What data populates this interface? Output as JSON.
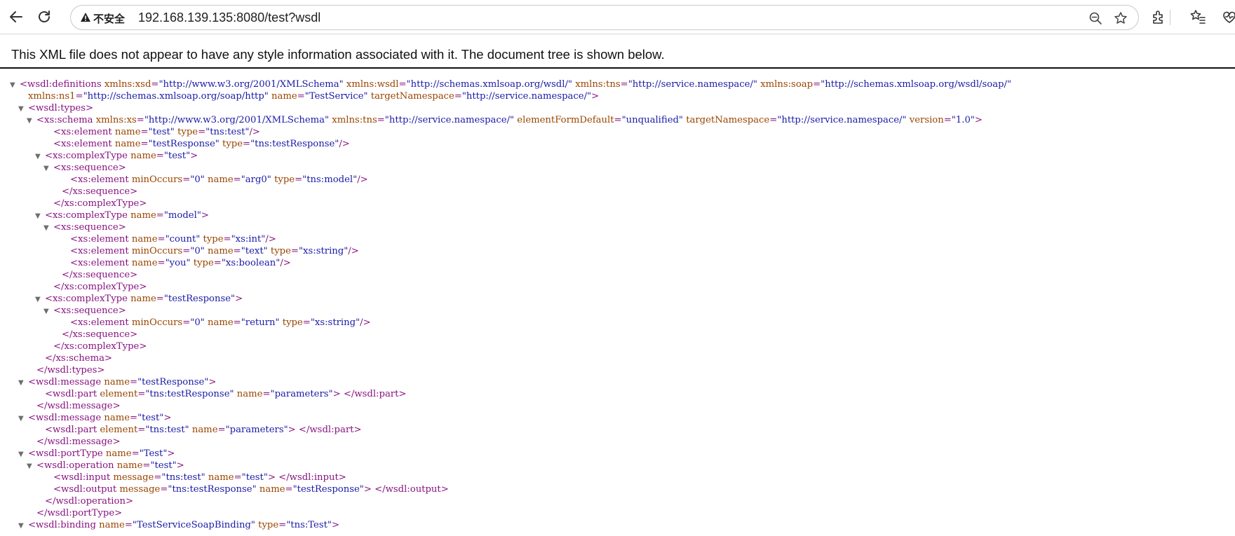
{
  "browser": {
    "security_label": "不安全",
    "url": "192.168.139.135:8080/test?wsdl",
    "icons": [
      "back-arrow-icon",
      "reload-icon",
      "warning-icon",
      "zoom-icon",
      "star-icon",
      "extensions-icon",
      "favorites-icon",
      "heart-pulse-icon"
    ]
  },
  "notice": "This XML file does not appear to have any style information associated with it. The document tree is shown below.",
  "colors": {
    "tag": "#881280",
    "attr": "#994500",
    "value": "#1a1aa6",
    "toggle": "#6e6e6e"
  },
  "xml_lines": [
    {
      "toggle": true,
      "parts": [
        [
          "t",
          "<wsdl:definitions "
        ],
        [
          "a",
          "xmlns:xsd"
        ],
        [
          "t",
          "="
        ],
        [
          "v",
          "\"http://www.w3.org/2001/XMLSchema\""
        ],
        [
          "t",
          " "
        ],
        [
          "a",
          "xmlns:wsdl"
        ],
        [
          "t",
          "="
        ],
        [
          "v",
          "\"http://schemas.xmlsoap.org/wsdl/\""
        ],
        [
          "t",
          " "
        ],
        [
          "a",
          "xmlns:tns"
        ],
        [
          "t",
          "="
        ],
        [
          "v",
          "\"http://service.namespace/\""
        ],
        [
          "t",
          " "
        ],
        [
          "a",
          "xmlns:soap"
        ],
        [
          "t",
          "="
        ],
        [
          "v",
          "\"http://schemas.xmlsoap.org/wsdl/soap/\""
        ]
      ]
    },
    {
      "indent": 1,
      "parts": [
        [
          "a",
          "xmlns:ns1"
        ],
        [
          "t",
          "="
        ],
        [
          "v",
          "\"http://schemas.xmlsoap.org/soap/http\""
        ],
        [
          "t",
          " "
        ],
        [
          "a",
          "name"
        ],
        [
          "t",
          "="
        ],
        [
          "v",
          "\"TestService\""
        ],
        [
          "t",
          " "
        ],
        [
          "a",
          "targetNamespace"
        ],
        [
          "t",
          "="
        ],
        [
          "v",
          "\"http://service.namespace/\""
        ],
        [
          "t",
          ">"
        ]
      ]
    },
    {
      "indent": 1,
      "toggle": true,
      "parts": [
        [
          "t",
          "<wsdl:types>"
        ]
      ]
    },
    {
      "indent": 2,
      "toggle": true,
      "parts": [
        [
          "t",
          "<xs:schema "
        ],
        [
          "a",
          "xmlns:xs"
        ],
        [
          "t",
          "="
        ],
        [
          "v",
          "\"http://www.w3.org/2001/XMLSchema\""
        ],
        [
          "t",
          " "
        ],
        [
          "a",
          "xmlns:tns"
        ],
        [
          "t",
          "="
        ],
        [
          "v",
          "\"http://service.namespace/\""
        ],
        [
          "t",
          " "
        ],
        [
          "a",
          "elementFormDefault"
        ],
        [
          "t",
          "="
        ],
        [
          "v",
          "\"unqualified\""
        ],
        [
          "t",
          " "
        ],
        [
          "a",
          "targetNamespace"
        ],
        [
          "t",
          "="
        ],
        [
          "v",
          "\"http://service.namespace/\""
        ],
        [
          "t",
          " "
        ],
        [
          "a",
          "version"
        ],
        [
          "t",
          "="
        ],
        [
          "v",
          "\"1.0\""
        ],
        [
          "t",
          ">"
        ]
      ]
    },
    {
      "indent": 4,
      "parts": [
        [
          "t",
          "<xs:element "
        ],
        [
          "a",
          "name"
        ],
        [
          "t",
          "="
        ],
        [
          "v",
          "\"test\""
        ],
        [
          "t",
          " "
        ],
        [
          "a",
          "type"
        ],
        [
          "t",
          "="
        ],
        [
          "v",
          "\"tns:test\""
        ],
        [
          "t",
          "/>"
        ]
      ]
    },
    {
      "indent": 4,
      "parts": [
        [
          "t",
          "<xs:element "
        ],
        [
          "a",
          "name"
        ],
        [
          "t",
          "="
        ],
        [
          "v",
          "\"testResponse\""
        ],
        [
          "t",
          " "
        ],
        [
          "a",
          "type"
        ],
        [
          "t",
          "="
        ],
        [
          "v",
          "\"tns:testResponse\""
        ],
        [
          "t",
          "/>"
        ]
      ]
    },
    {
      "indent": 3,
      "toggle": true,
      "parts": [
        [
          "t",
          "<xs:complexType "
        ],
        [
          "a",
          "name"
        ],
        [
          "t",
          "="
        ],
        [
          "v",
          "\"test\""
        ],
        [
          "t",
          ">"
        ]
      ]
    },
    {
      "indent": 4,
      "toggle": true,
      "parts": [
        [
          "t",
          "<xs:sequence>"
        ]
      ]
    },
    {
      "indent": 6,
      "parts": [
        [
          "t",
          "<xs:element "
        ],
        [
          "a",
          "minOccurs"
        ],
        [
          "t",
          "="
        ],
        [
          "v",
          "\"0\""
        ],
        [
          "t",
          " "
        ],
        [
          "a",
          "name"
        ],
        [
          "t",
          "="
        ],
        [
          "v",
          "\"arg0\""
        ],
        [
          "t",
          " "
        ],
        [
          "a",
          "type"
        ],
        [
          "t",
          "="
        ],
        [
          "v",
          "\"tns:model\""
        ],
        [
          "t",
          "/>"
        ]
      ]
    },
    {
      "indent": 5,
      "parts": [
        [
          "t",
          "</xs:sequence>"
        ]
      ]
    },
    {
      "indent": 4,
      "parts": [
        [
          "t",
          "</xs:complexType>"
        ]
      ]
    },
    {
      "indent": 3,
      "toggle": true,
      "parts": [
        [
          "t",
          "<xs:complexType "
        ],
        [
          "a",
          "name"
        ],
        [
          "t",
          "="
        ],
        [
          "v",
          "\"model\""
        ],
        [
          "t",
          ">"
        ]
      ]
    },
    {
      "indent": 4,
      "toggle": true,
      "parts": [
        [
          "t",
          "<xs:sequence>"
        ]
      ]
    },
    {
      "indent": 6,
      "parts": [
        [
          "t",
          "<xs:element "
        ],
        [
          "a",
          "name"
        ],
        [
          "t",
          "="
        ],
        [
          "v",
          "\"count\""
        ],
        [
          "t",
          " "
        ],
        [
          "a",
          "type"
        ],
        [
          "t",
          "="
        ],
        [
          "v",
          "\"xs:int\""
        ],
        [
          "t",
          "/>"
        ]
      ]
    },
    {
      "indent": 6,
      "parts": [
        [
          "t",
          "<xs:element "
        ],
        [
          "a",
          "minOccurs"
        ],
        [
          "t",
          "="
        ],
        [
          "v",
          "\"0\""
        ],
        [
          "t",
          " "
        ],
        [
          "a",
          "name"
        ],
        [
          "t",
          "="
        ],
        [
          "v",
          "\"text\""
        ],
        [
          "t",
          " "
        ],
        [
          "a",
          "type"
        ],
        [
          "t",
          "="
        ],
        [
          "v",
          "\"xs:string\""
        ],
        [
          "t",
          "/>"
        ]
      ]
    },
    {
      "indent": 6,
      "parts": [
        [
          "t",
          "<xs:element "
        ],
        [
          "a",
          "name"
        ],
        [
          "t",
          "="
        ],
        [
          "v",
          "\"you\""
        ],
        [
          "t",
          " "
        ],
        [
          "a",
          "type"
        ],
        [
          "t",
          "="
        ],
        [
          "v",
          "\"xs:boolean\""
        ],
        [
          "t",
          "/>"
        ]
      ]
    },
    {
      "indent": 5,
      "parts": [
        [
          "t",
          "</xs:sequence>"
        ]
      ]
    },
    {
      "indent": 4,
      "parts": [
        [
          "t",
          "</xs:complexType>"
        ]
      ]
    },
    {
      "indent": 3,
      "toggle": true,
      "parts": [
        [
          "t",
          "<xs:complexType "
        ],
        [
          "a",
          "name"
        ],
        [
          "t",
          "="
        ],
        [
          "v",
          "\"testResponse\""
        ],
        [
          "t",
          ">"
        ]
      ]
    },
    {
      "indent": 4,
      "toggle": true,
      "parts": [
        [
          "t",
          "<xs:sequence>"
        ]
      ]
    },
    {
      "indent": 6,
      "parts": [
        [
          "t",
          "<xs:element "
        ],
        [
          "a",
          "minOccurs"
        ],
        [
          "t",
          "="
        ],
        [
          "v",
          "\"0\""
        ],
        [
          "t",
          " "
        ],
        [
          "a",
          "name"
        ],
        [
          "t",
          "="
        ],
        [
          "v",
          "\"return\""
        ],
        [
          "t",
          " "
        ],
        [
          "a",
          "type"
        ],
        [
          "t",
          "="
        ],
        [
          "v",
          "\"xs:string\""
        ],
        [
          "t",
          "/>"
        ]
      ]
    },
    {
      "indent": 5,
      "parts": [
        [
          "t",
          "</xs:sequence>"
        ]
      ]
    },
    {
      "indent": 4,
      "parts": [
        [
          "t",
          "</xs:complexType>"
        ]
      ]
    },
    {
      "indent": 3,
      "parts": [
        [
          "t",
          "</xs:schema>"
        ]
      ]
    },
    {
      "indent": 2,
      "parts": [
        [
          "t",
          "</wsdl:types>"
        ]
      ]
    },
    {
      "indent": 1,
      "toggle": true,
      "parts": [
        [
          "t",
          "<wsdl:message "
        ],
        [
          "a",
          "name"
        ],
        [
          "t",
          "="
        ],
        [
          "v",
          "\"testResponse\""
        ],
        [
          "t",
          ">"
        ]
      ]
    },
    {
      "indent": 3,
      "parts": [
        [
          "t",
          "<wsdl:part "
        ],
        [
          "a",
          "element"
        ],
        [
          "t",
          "="
        ],
        [
          "v",
          "\"tns:testResponse\""
        ],
        [
          "t",
          " "
        ],
        [
          "a",
          "name"
        ],
        [
          "t",
          "="
        ],
        [
          "v",
          "\"parameters\""
        ],
        [
          "t",
          "> </wsdl:part>"
        ]
      ]
    },
    {
      "indent": 2,
      "parts": [
        [
          "t",
          "</wsdl:message>"
        ]
      ]
    },
    {
      "indent": 1,
      "toggle": true,
      "parts": [
        [
          "t",
          "<wsdl:message "
        ],
        [
          "a",
          "name"
        ],
        [
          "t",
          "="
        ],
        [
          "v",
          "\"test\""
        ],
        [
          "t",
          ">"
        ]
      ]
    },
    {
      "indent": 3,
      "parts": [
        [
          "t",
          "<wsdl:part "
        ],
        [
          "a",
          "element"
        ],
        [
          "t",
          "="
        ],
        [
          "v",
          "\"tns:test\""
        ],
        [
          "t",
          " "
        ],
        [
          "a",
          "name"
        ],
        [
          "t",
          "="
        ],
        [
          "v",
          "\"parameters\""
        ],
        [
          "t",
          "> </wsdl:part>"
        ]
      ]
    },
    {
      "indent": 2,
      "parts": [
        [
          "t",
          "</wsdl:message>"
        ]
      ]
    },
    {
      "indent": 1,
      "toggle": true,
      "parts": [
        [
          "t",
          "<wsdl:portType "
        ],
        [
          "a",
          "name"
        ],
        [
          "t",
          "="
        ],
        [
          "v",
          "\"Test\""
        ],
        [
          "t",
          ">"
        ]
      ]
    },
    {
      "indent": 2,
      "toggle": true,
      "parts": [
        [
          "t",
          "<wsdl:operation "
        ],
        [
          "a",
          "name"
        ],
        [
          "t",
          "="
        ],
        [
          "v",
          "\"test\""
        ],
        [
          "t",
          ">"
        ]
      ]
    },
    {
      "indent": 4,
      "parts": [
        [
          "t",
          "<wsdl:input "
        ],
        [
          "a",
          "message"
        ],
        [
          "t",
          "="
        ],
        [
          "v",
          "\"tns:test\""
        ],
        [
          "t",
          " "
        ],
        [
          "a",
          "name"
        ],
        [
          "t",
          "="
        ],
        [
          "v",
          "\"test\""
        ],
        [
          "t",
          "> </wsdl:input>"
        ]
      ]
    },
    {
      "indent": 4,
      "parts": [
        [
          "t",
          "<wsdl:output "
        ],
        [
          "a",
          "message"
        ],
        [
          "t",
          "="
        ],
        [
          "v",
          "\"tns:testResponse\""
        ],
        [
          "t",
          " "
        ],
        [
          "a",
          "name"
        ],
        [
          "t",
          "="
        ],
        [
          "v",
          "\"testResponse\""
        ],
        [
          "t",
          "> </wsdl:output>"
        ]
      ]
    },
    {
      "indent": 3,
      "parts": [
        [
          "t",
          "</wsdl:operation>"
        ]
      ]
    },
    {
      "indent": 2,
      "parts": [
        [
          "t",
          "</wsdl:portType>"
        ]
      ]
    },
    {
      "indent": 1,
      "toggle": true,
      "parts": [
        [
          "t",
          "<wsdl:binding "
        ],
        [
          "a",
          "name"
        ],
        [
          "t",
          "="
        ],
        [
          "v",
          "\"TestServiceSoapBinding\""
        ],
        [
          "t",
          " "
        ],
        [
          "a",
          "type"
        ],
        [
          "t",
          "="
        ],
        [
          "v",
          "\"tns:Test\""
        ],
        [
          "t",
          ">"
        ]
      ]
    }
  ]
}
